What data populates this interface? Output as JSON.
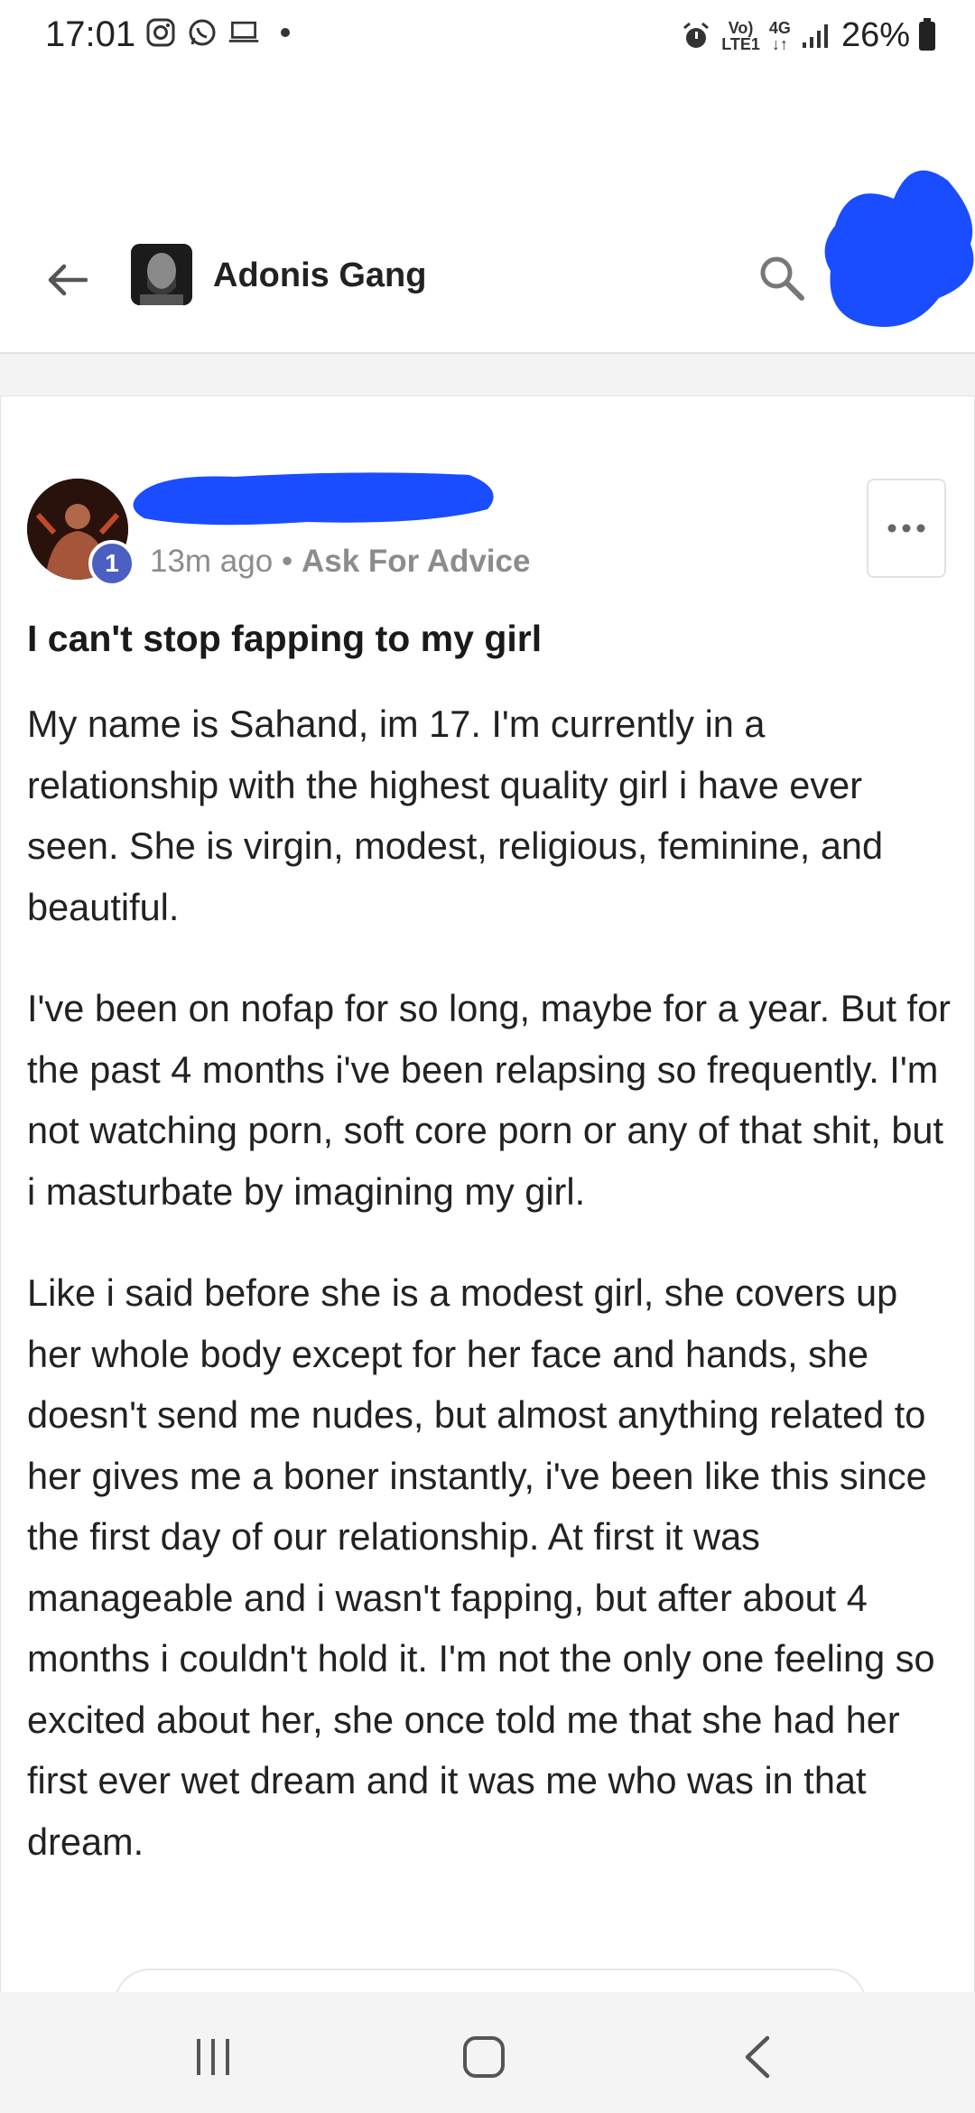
{
  "status_bar": {
    "time": "17:01",
    "network_top": "Vo)",
    "network_bottom": "LTE1",
    "signal_type": "4G",
    "battery": "26%"
  },
  "header": {
    "group_name": "Adonis Gang",
    "back_icon": "arrow-left-icon",
    "search_icon": "search-icon"
  },
  "post": {
    "level": "1",
    "time_ago": "13m ago",
    "separator": "•",
    "category": "Ask For Advice",
    "title": "I can't stop fapping to my girl",
    "paragraphs": [
      "My name is Sahand, im 17. I'm currently in a relationship with the highest quality girl i have ever seen. She is virgin, modest, religious, feminine, and beautiful.",
      "I've been on nofap for so long, maybe for a year. But for the past 4 months i've been relapsing so frequently. I'm not watching porn, soft core porn or any of that shit, but i masturbate by imagining my girl.",
      "Like i said before she is a modest girl, she covers up her whole body except for her face and hands, she doesn't send me nudes, but almost anything related to her gives me a boner instantly, i've been like this since the first day of our relationship. At first it was manageable and i wasn't fapping, but after about 4 months i couldn't hold it. I'm not the only one feeling so excited about her, she once told me that she had her first ever wet dream and it was me who was in that dream."
    ]
  },
  "colors": {
    "badge": "#4a5fc1",
    "redaction": "#1a4dff",
    "muted_text": "#8c8c8c"
  }
}
